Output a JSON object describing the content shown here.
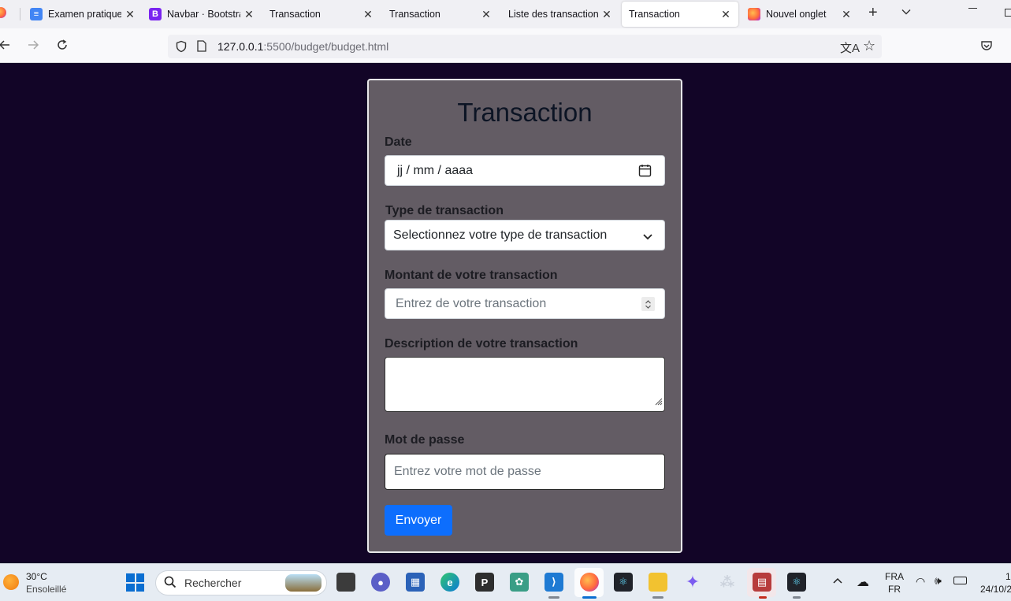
{
  "browser": {
    "tabs": [
      {
        "title": "Examen pratique",
        "icon": "google-docs-icon",
        "active": false
      },
      {
        "title": "Navbar · Bootstrap",
        "icon": "bootstrap-icon",
        "active": false
      },
      {
        "title": "Transaction",
        "icon": "",
        "active": false
      },
      {
        "title": "Transaction",
        "icon": "",
        "active": false
      },
      {
        "title": "Liste des transactions",
        "icon": "",
        "active": false
      },
      {
        "title": "Transaction",
        "icon": "",
        "active": true
      },
      {
        "title": "Nouvel onglet",
        "icon": "firefox-icon",
        "active": false
      }
    ],
    "url_host": "127.0.0.1",
    "url_rest": ":5500/budget/budget.html"
  },
  "form": {
    "title": "Transaction",
    "date_label": "Date",
    "date_placeholder": "jj / mm / aaaa",
    "type_label": "Type de transaction",
    "type_selected": "Selectionnez votre type de transaction",
    "amount_label": "Montant de votre transaction",
    "amount_placeholder": "Entrez de votre transaction",
    "description_label": "Description de votre transaction",
    "description_value": "",
    "password_label": "Mot de passe",
    "password_placeholder": "Entrez votre mot de passe",
    "submit_label": "Envoyer"
  },
  "colors": {
    "page_background": "#120527",
    "card_background": "#635c64",
    "button_primary": "#0d6efd",
    "title_color": "#0c1424"
  },
  "taskbar": {
    "weather_temp": "30°C",
    "weather_desc": "Ensoleillé",
    "search_placeholder": "Rechercher",
    "language_line1": "FRA",
    "language_line2": "FR",
    "time_partial": "1",
    "date_partial": "24/10/2"
  }
}
